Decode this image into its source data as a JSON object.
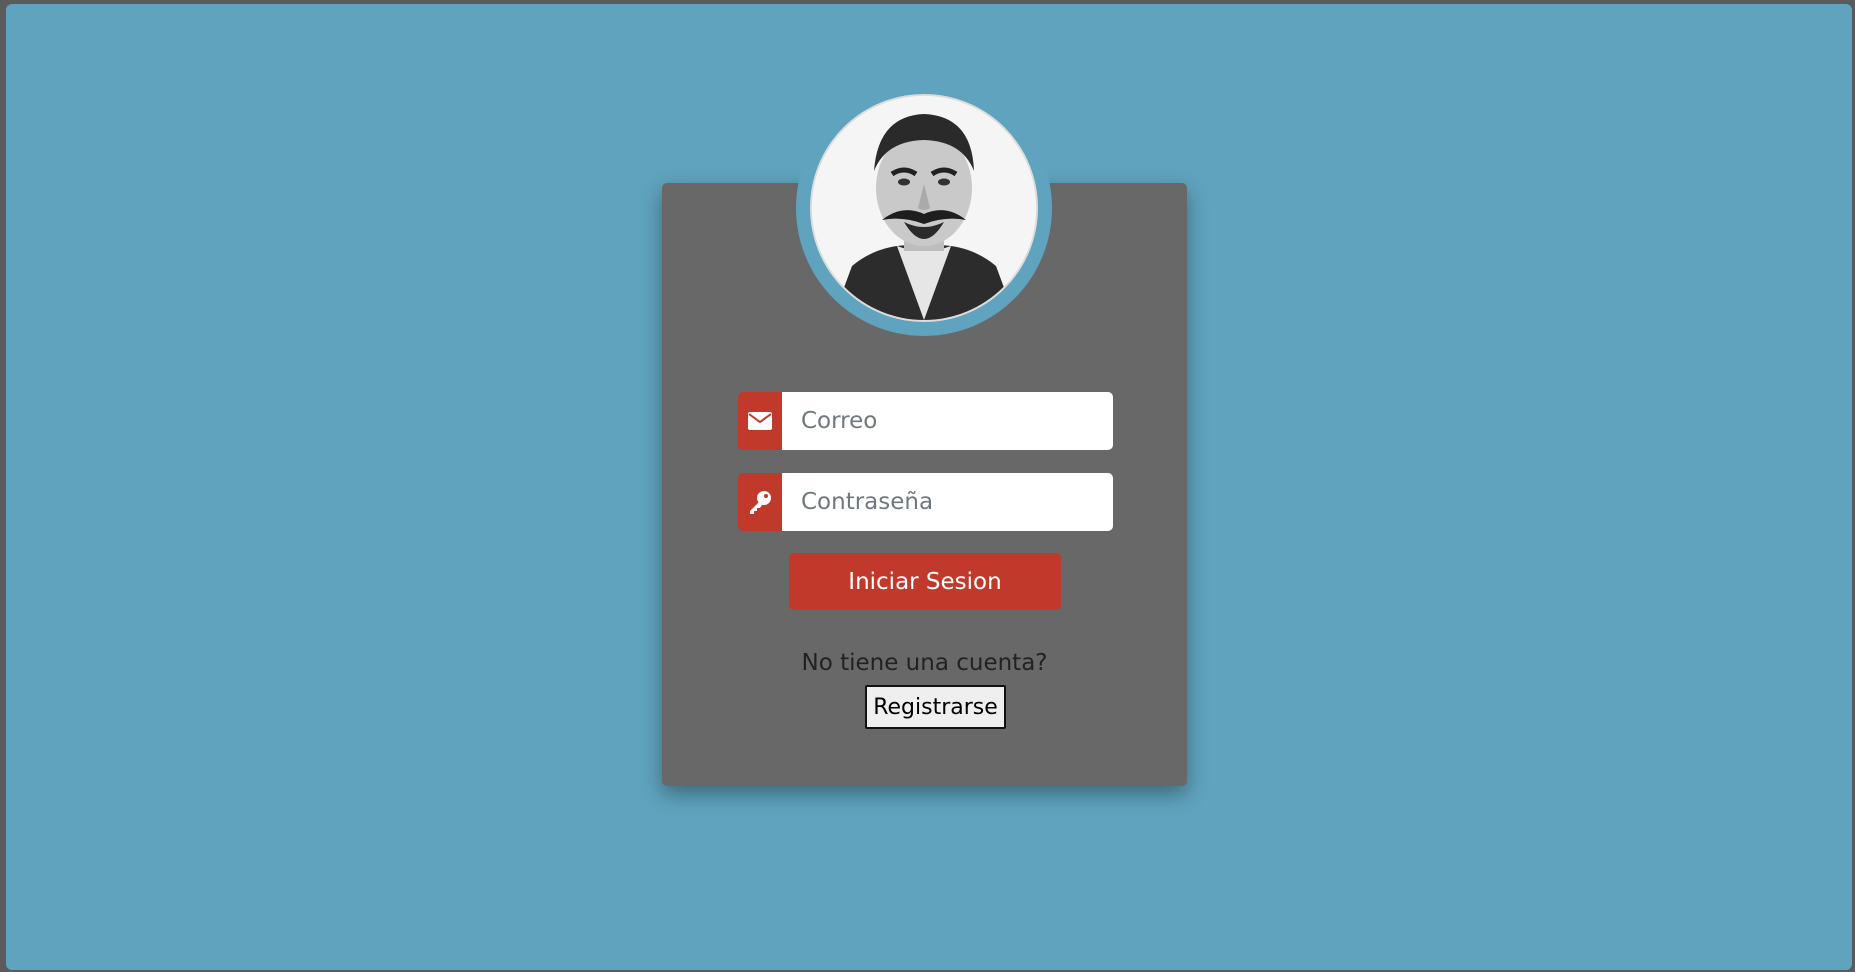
{
  "login_form": {
    "email": {
      "placeholder": "Correo",
      "value": "",
      "icon": "envelope-icon"
    },
    "password": {
      "placeholder": "Contraseña",
      "value": "",
      "icon": "key-icon"
    },
    "submit_label": "Iniciar Sesion",
    "no_account_text": "No tiene una cuenta?",
    "register_label": "Registrarse"
  },
  "colors": {
    "background": "#5fa3be",
    "card": "#686868",
    "accent": "#c0392b",
    "input": "#ffffff"
  }
}
